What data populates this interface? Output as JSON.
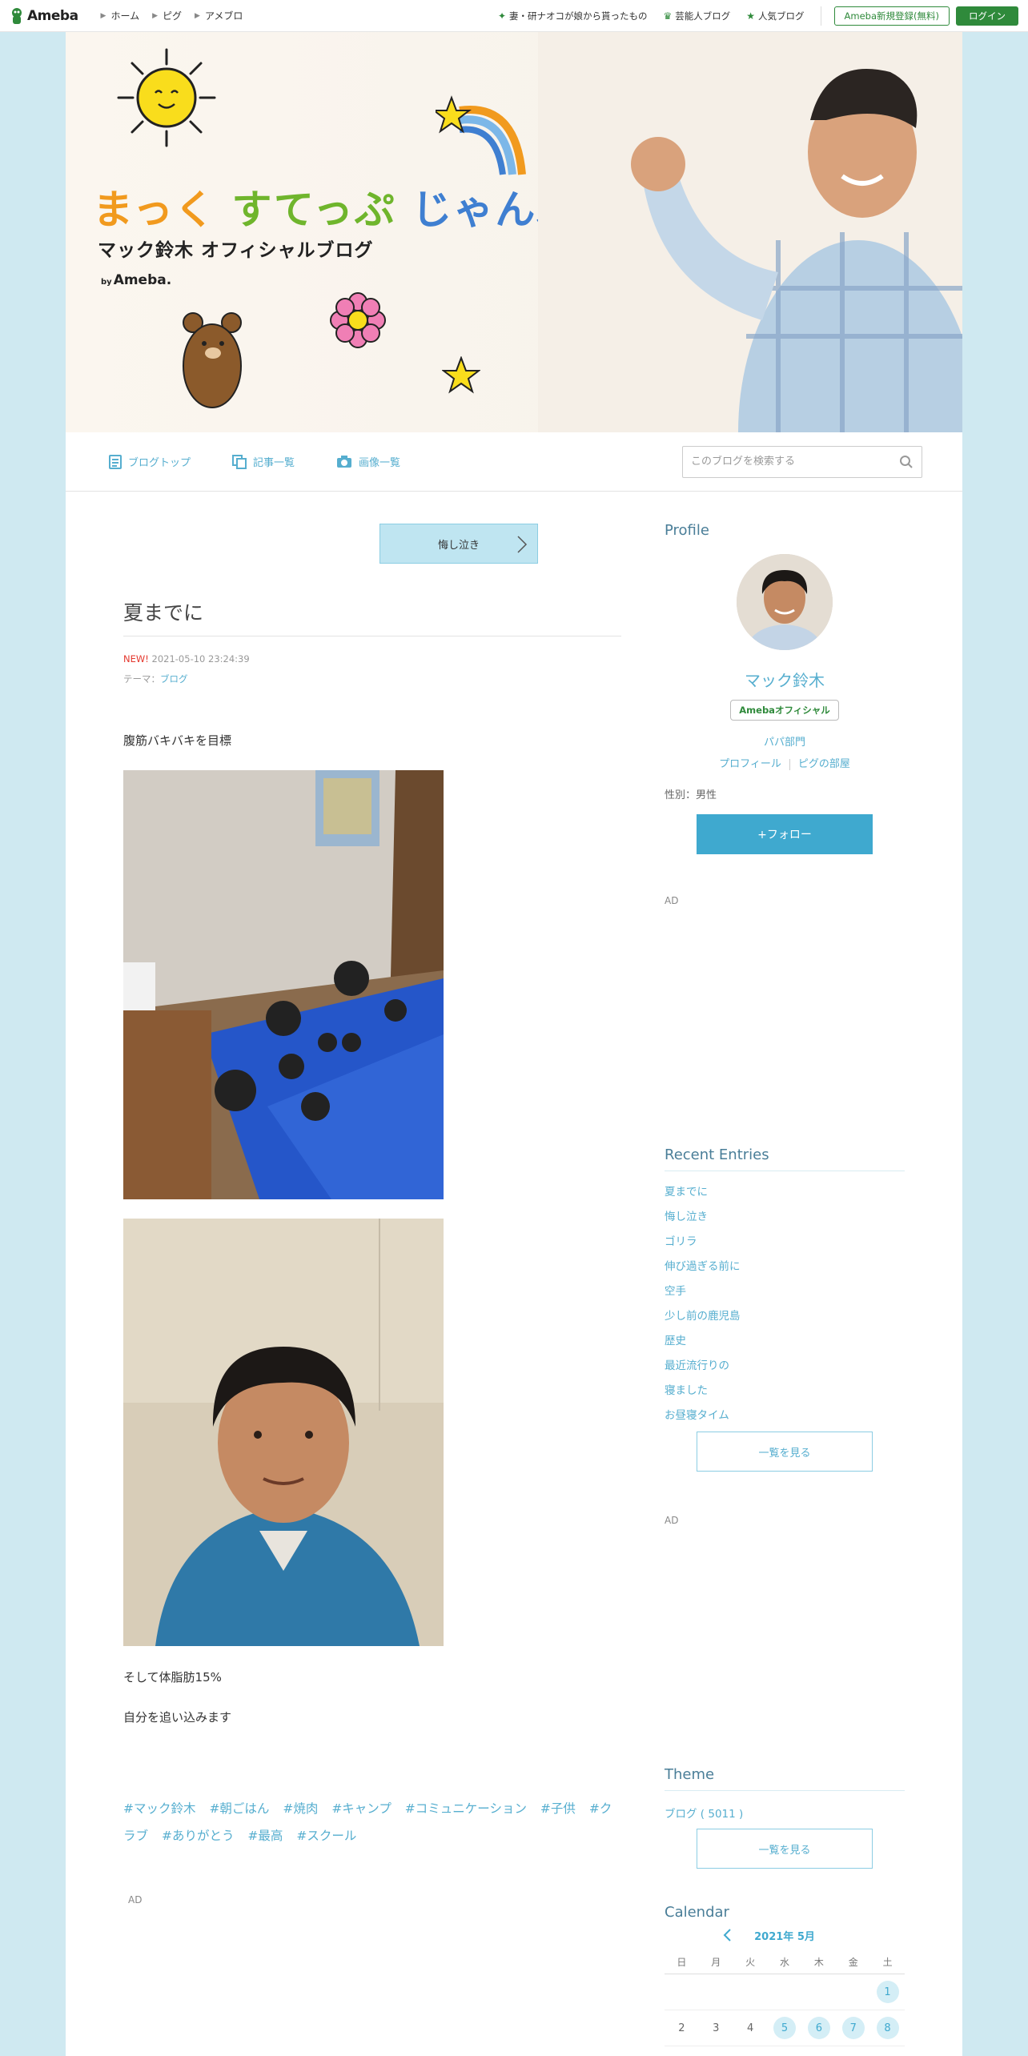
{
  "topbar": {
    "logo": "Ameba",
    "nav": [
      "ホーム",
      "ピグ",
      "アメブロ"
    ],
    "links": [
      "妻・研ナオコが娘から貰ったもの",
      "芸能人ブログ",
      "人気ブログ"
    ],
    "register": "Ameba新規登録(無料)",
    "login": "ログイン"
  },
  "header": {
    "title_part1": "まっく",
    "title_part2": "すてっぷ",
    "title_part3": "じゃんぷ",
    "subtitle": "マック鈴木 オフィシャルブログ",
    "by": "by",
    "by_brand": "Ameba."
  },
  "blognav": {
    "items": [
      "ブログトップ",
      "記事一覧",
      "画像一覧"
    ],
    "search_placeholder": "このブログを検索する"
  },
  "entry": {
    "prev_label": "悔し泣き",
    "title": "夏までに",
    "new_badge": "NEW!",
    "datetime": "2021-05-10 23:24:39",
    "theme_label": "テーマ：",
    "theme": "ブログ",
    "text1": "腹筋バキバキを目標",
    "text2": "そして体脂肪15%",
    "text3": "自分を追い込みます",
    "hashtags": [
      "#マック鈴木",
      "#朝ごはん",
      "#焼肉",
      "#キャンプ",
      "#コミュニケーション",
      "#子供",
      "#クラブ",
      "#ありがとう",
      "#最高",
      "#スクール"
    ],
    "ad": "AD"
  },
  "sidebar": {
    "profile_heading": "Profile",
    "name": "マック鈴木",
    "official_badge": "Amebaオフィシャル",
    "category": "パパ部門",
    "profile_link": "プロフィール",
    "pig_link": "ピグの部屋",
    "gender": "性別：男性",
    "follow": "+フォロー",
    "ad1": "AD",
    "recent_heading": "Recent Entries",
    "recent": [
      "夏までに",
      "悔し泣き",
      "ゴリラ",
      "伸び過ぎる前に",
      "空手",
      "少し前の鹿児島",
      "歴史",
      "最近流行りの",
      "寝ました",
      "お昼寝タイム"
    ],
    "see_all": "一覧を見る",
    "ad2": "AD",
    "theme_heading": "Theme",
    "theme_item": "ブログ ( 5011 )",
    "theme_see_all": "一覧を見る",
    "calendar_heading": "Calendar",
    "calendar_month": "2021年 5月",
    "weekdays": [
      "日",
      "月",
      "火",
      "水",
      "木",
      "金",
      "土"
    ],
    "week1": [
      "",
      "",
      "",
      "",
      "",
      "",
      "1"
    ],
    "week2": [
      "2",
      "3",
      "4",
      "5",
      "6",
      "7",
      "8"
    ]
  },
  "colors": {
    "accent": "#56aecf",
    "brand_green": "#2f8a3b",
    "bg": "#cfe9f1"
  }
}
